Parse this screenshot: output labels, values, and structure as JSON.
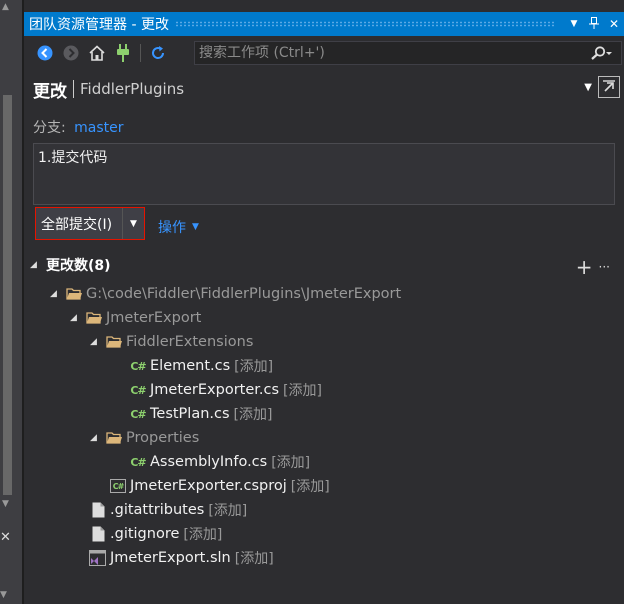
{
  "window": {
    "title": "团队资源管理器 - 更改",
    "controls": {
      "dropdown": "▼",
      "pin": "⊥",
      "close": "✕"
    }
  },
  "toolbar": {
    "buttons": [
      "back-icon",
      "forward-icon",
      "home-icon",
      "plug-icon",
      "refresh-icon"
    ],
    "search_placeholder": "搜索工作项 (Ctrl+')"
  },
  "header": {
    "title": "更改",
    "subtitle": "FiddlerPlugins"
  },
  "branch": {
    "label": "分支:",
    "value": "master"
  },
  "commit_message": "1.提交代码",
  "commit": {
    "button_label": "全部提交(I)",
    "actions_label": "操作"
  },
  "changes": {
    "title": "更改数(8)",
    "add_symbol": "+",
    "more_symbol": "···",
    "tree": [
      {
        "name": "G:\\code\\Fiddler\\FiddlerPlugins\\JmeterExport",
        "tag": "",
        "type": "folder",
        "expanded": true
      },
      {
        "name": "JmeterExport",
        "tag": "",
        "type": "folder",
        "expanded": true
      },
      {
        "name": "FiddlerExtensions",
        "tag": "",
        "type": "folder",
        "expanded": true
      },
      {
        "name": "Element.cs",
        "tag": "[添加]",
        "type": "cs"
      },
      {
        "name": "JmeterExporter.cs",
        "tag": "[添加]",
        "type": "cs"
      },
      {
        "name": "TestPlan.cs",
        "tag": "[添加]",
        "type": "cs"
      },
      {
        "name": "Properties",
        "tag": "",
        "type": "folder",
        "expanded": true
      },
      {
        "name": "AssemblyInfo.cs",
        "tag": "[添加]",
        "type": "cs"
      },
      {
        "name": "JmeterExporter.csproj",
        "tag": "[添加]",
        "type": "csproj"
      },
      {
        "name": ".gitattributes",
        "tag": "[添加]",
        "type": "file"
      },
      {
        "name": ".gitignore",
        "tag": "[添加]",
        "type": "file"
      },
      {
        "name": "JmeterExport.sln",
        "tag": "[添加]",
        "type": "sln"
      }
    ]
  },
  "colors": {
    "accent": "#007acc",
    "link": "#3794ff",
    "background": "#2d2d30",
    "highlight_border": "#e51400",
    "cs_icon": "#8dd06e"
  },
  "icons": {
    "cs": "C#",
    "csproj": "C#"
  }
}
